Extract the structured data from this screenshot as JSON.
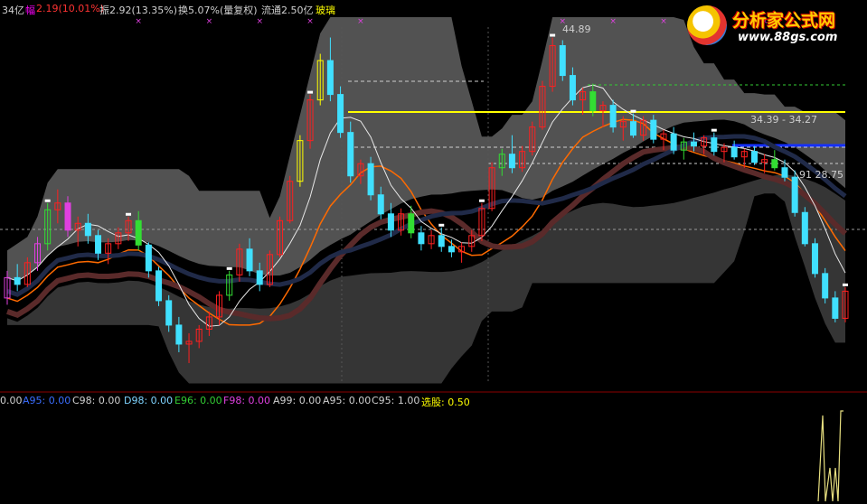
{
  "header": {
    "items": [
      {
        "text": "34亿",
        "color": "#d0d0d0"
      },
      {
        "text": "幅",
        "color": "#ff00ff"
      },
      {
        "text": "2.19(10.01%)",
        "color": "#ff3333"
      },
      {
        "text": "振2.92(13.35%)",
        "color": "#d0d0d0"
      },
      {
        "text": "换5.07%",
        "color": "#d0d0d0"
      },
      {
        "text": "(量复权)",
        "color": "#d0d0d0"
      },
      {
        "text": "流通2.50亿",
        "color": "#d0d0d0"
      },
      {
        "text": "玻璃",
        "color": "#ffff00"
      }
    ]
  },
  "logo": {
    "title": "分析家公式网",
    "url": "www.88gs.com"
  },
  "chart_data": {
    "type": "candlestick",
    "price_labels": [
      {
        "text": "44.89",
        "price": 44.89
      },
      {
        "text": "34.39 - 34.27",
        "price": 34.33
      },
      {
        "text": "91   28.75",
        "price": 28.75
      }
    ],
    "candles": [
      [
        26,
        28,
        25.5,
        27.5
      ],
      [
        27.5,
        28.5,
        26.5,
        27
      ],
      [
        27,
        29,
        26.8,
        28.6
      ],
      [
        28.6,
        30.5,
        28,
        30
      ],
      [
        30,
        33,
        29.5,
        32.5
      ],
      [
        32.5,
        34,
        31.5,
        33
      ],
      [
        33,
        33.5,
        30.5,
        31
      ],
      [
        31,
        32,
        29.8,
        31.5
      ],
      [
        31.5,
        32.2,
        30,
        30.6
      ],
      [
        30.6,
        31,
        28.8,
        29.3
      ],
      [
        29.3,
        30.4,
        28.5,
        30
      ],
      [
        30,
        31.2,
        29.6,
        30.8
      ],
      [
        30.8,
        32,
        30.2,
        31.7
      ],
      [
        31.7,
        32.4,
        29.5,
        29.9
      ],
      [
        29.9,
        30.1,
        27.5,
        28
      ],
      [
        28,
        28.3,
        25.4,
        25.8
      ],
      [
        25.8,
        26.2,
        23.5,
        24
      ],
      [
        24,
        24.6,
        22,
        22.6
      ],
      [
        22.6,
        23.4,
        21.2,
        22.8
      ],
      [
        22.8,
        24,
        22.3,
        23.7
      ],
      [
        23.7,
        25,
        23.2,
        24.6
      ],
      [
        24.6,
        26.5,
        24,
        26.2
      ],
      [
        26.2,
        28,
        25.8,
        27.7
      ],
      [
        27.7,
        30,
        27.2,
        29.6
      ],
      [
        29.6,
        30.4,
        27.6,
        28
      ],
      [
        28,
        28.6,
        26.5,
        27
      ],
      [
        27,
        29.5,
        26.8,
        29.2
      ],
      [
        29.2,
        32,
        29,
        31.7
      ],
      [
        31.7,
        35,
        31.5,
        34.6
      ],
      [
        34.6,
        38,
        34.2,
        37.6
      ],
      [
        37.6,
        41,
        37,
        40.6
      ],
      [
        40.6,
        44,
        40.2,
        43.5
      ],
      [
        43.5,
        45.2,
        40.5,
        41
      ],
      [
        41,
        41.6,
        37.8,
        38.2
      ],
      [
        38.2,
        39,
        34.5,
        35
      ],
      [
        35,
        36.2,
        34.4,
        35.9
      ],
      [
        35.9,
        36.4,
        33.2,
        33.6
      ],
      [
        33.6,
        34.2,
        31.8,
        32.2
      ],
      [
        32.2,
        33,
        30.5,
        31
      ],
      [
        31,
        32.6,
        30.6,
        32.2
      ],
      [
        32.2,
        32.8,
        30.4,
        30.8
      ],
      [
        30.8,
        31.3,
        29.5,
        30
      ],
      [
        30,
        31,
        29.6,
        30.6
      ],
      [
        30.6,
        31.2,
        29.4,
        29.8
      ],
      [
        29.8,
        30.3,
        29,
        29.4
      ],
      [
        29.4,
        30.1,
        28.6,
        29.8
      ],
      [
        29.8,
        31,
        29.4,
        30.6
      ],
      [
        30.6,
        33,
        30.2,
        32.6
      ],
      [
        32.6,
        36,
        32.4,
        35.6
      ],
      [
        35.6,
        37,
        35,
        36.6
      ],
      [
        36.6,
        38,
        35.2,
        35.6
      ],
      [
        35.6,
        37.2,
        35.3,
        36.8
      ],
      [
        36.8,
        39,
        36.5,
        38.6
      ],
      [
        38.6,
        42,
        38.4,
        41.6
      ],
      [
        41.6,
        45.2,
        41.2,
        44.6
      ],
      [
        44.6,
        45,
        42,
        42.4
      ],
      [
        42.4,
        43,
        40.2,
        40.6
      ],
      [
        40.6,
        41.5,
        39.5,
        41.2
      ],
      [
        41.2,
        41.8,
        39.4,
        39.8
      ],
      [
        39.8,
        40.5,
        38.6,
        40.2
      ],
      [
        40.2,
        40.6,
        38.2,
        38.6
      ],
      [
        38.6,
        39.4,
        37.6,
        39
      ],
      [
        39,
        39.6,
        37.8,
        38
      ],
      [
        38,
        39.4,
        37.6,
        39.1
      ],
      [
        39.1,
        39.5,
        37.4,
        37.7
      ],
      [
        37.7,
        38.4,
        36.9,
        38.1
      ],
      [
        38.1,
        38.6,
        36.6,
        36.9
      ],
      [
        36.9,
        37.8,
        36.2,
        37.5
      ],
      [
        37.5,
        38.2,
        36.8,
        37.2
      ],
      [
        37.2,
        38,
        36.6,
        37.8
      ],
      [
        37.8,
        38.2,
        36.5,
        36.8
      ],
      [
        36.8,
        37.4,
        36,
        37.1
      ],
      [
        37.1,
        37.6,
        36.2,
        36.4
      ],
      [
        36.4,
        37,
        35.6,
        36.8
      ],
      [
        36.8,
        37.2,
        35.8,
        36
      ],
      [
        36,
        36.6,
        35.2,
        36.2
      ],
      [
        36.2,
        36.9,
        35.4,
        35.6
      ],
      [
        35.6,
        36.2,
        34.6,
        34.9
      ],
      [
        34.9,
        35.4,
        32,
        32.3
      ],
      [
        32.3,
        32.7,
        29.8,
        30
      ],
      [
        30,
        30.4,
        27.5,
        27.8
      ],
      [
        27.8,
        28.2,
        25.6,
        26
      ],
      [
        26,
        26.5,
        24.2,
        24.5
      ],
      [
        24.5,
        26.8,
        24.2,
        26.5
      ]
    ]
  },
  "subpanel": {
    "items": [
      {
        "text": "0.00",
        "color": "#d0d0d0"
      },
      {
        "text": "A95: 0.00",
        "color": "#3a6dff"
      },
      {
        "text": "C98: 0.00",
        "color": "#d0d0d0"
      },
      {
        "text": "D98: 0.00",
        "color": "#7fd4ff"
      },
      {
        "text": "E96: 0.00",
        "color": "#33cc33"
      },
      {
        "text": "F98: 0.00",
        "color": "#e040e0"
      },
      {
        "text": "A99: 0.00",
        "color": "#d0d0d0"
      },
      {
        "text": "A95: 0.00",
        "color": "#d0d0d0"
      },
      {
        "text": "C95: 1.00",
        "color": "#d0d0d0"
      },
      {
        "text": "选股: 0.50",
        "color": "#ffff00"
      }
    ]
  }
}
